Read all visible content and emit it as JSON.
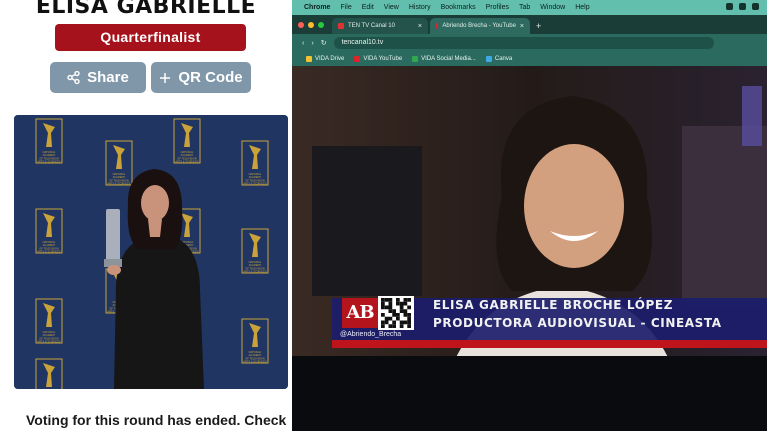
{
  "nominee": {
    "name": "ELISA GABRIELLE",
    "status_badge": "Quarterfinalist"
  },
  "actions": {
    "share_label": "Share",
    "qrcode_label": "QR Code"
  },
  "voting_notice": "Voting for this round has ended. Check",
  "backdrop_text": [
    "NATIONAL",
    "ACADEMY",
    "OF TELEVISION",
    "ARTS & SCIENCES"
  ],
  "browser": {
    "menu": [
      "Chrome",
      "File",
      "Edit",
      "View",
      "History",
      "Bookmarks",
      "Profiles",
      "Tab",
      "Window",
      "Help"
    ],
    "tabs": [
      {
        "label": "TEN TV Canal 10"
      },
      {
        "label": "Abriendo Brecha - YouTube"
      }
    ],
    "new_tab_symbol": "+",
    "close_symbol": "×",
    "url": "tencanal10.tv",
    "bookmarks": [
      {
        "label": "VIDA Drive",
        "color": "#f2c230"
      },
      {
        "label": "VIDA YouTube",
        "color": "#e2222b"
      },
      {
        "label": "VIDA Social Media...",
        "color": "#2fa84f"
      },
      {
        "label": "Canva",
        "color": "#3fa9e6"
      }
    ]
  },
  "broadcast": {
    "logo_text": "AB",
    "handle": "@Abriendo_Brecha",
    "name_line": "ELISA GABRIELLE BROCHE LÓPEZ",
    "title_line": "PRODUCTORA AUDIOVISUAL - CINEASTA"
  },
  "colors": {
    "badge_red": "#a5121b",
    "button_gray": "#7f97a8",
    "backdrop_blue": "#203561",
    "emmy_gold": "#c9a23a",
    "browser_teal": "#2b6a5f",
    "lower_third_red": "#c0141d"
  }
}
